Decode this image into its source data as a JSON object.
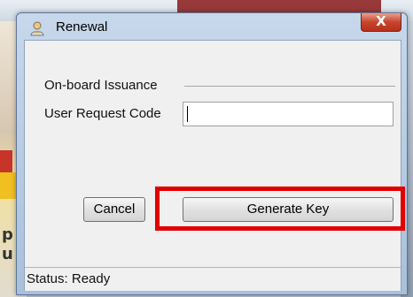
{
  "window": {
    "title": "Renewal",
    "close_symbol": "X"
  },
  "form": {
    "group_label": "On-board Issuance",
    "request_code_label": "User Request Code",
    "request_code_value": "",
    "request_code_placeholder": ""
  },
  "buttons": {
    "cancel_label": "Cancel",
    "generate_label": "Generate Key"
  },
  "status": {
    "text": "Status: Ready"
  },
  "background": {
    "left_letters": "p\nu"
  },
  "colors": {
    "highlight": "#e00000",
    "close_button": "#c7442d"
  },
  "icons": {
    "title": "user-key-icon",
    "close": "close-icon"
  }
}
